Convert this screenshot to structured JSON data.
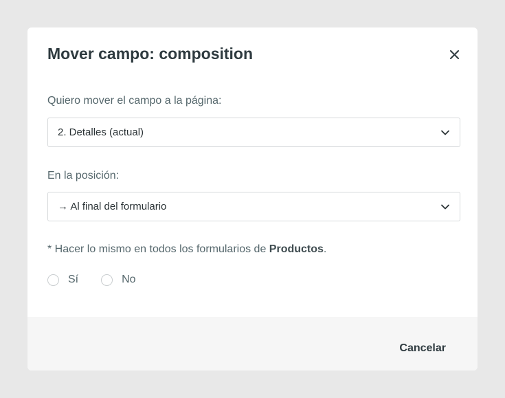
{
  "dialog": {
    "title": "Mover campo: composition",
    "close_icon": "close-icon"
  },
  "page_field": {
    "label": "Quiero mover el campo a la página:",
    "selected": "2. Detalles (actual)"
  },
  "position_field": {
    "label": "En la posición:",
    "selected": "→ Al final del formulario"
  },
  "apply_all": {
    "prefix": "* Hacer lo mismo en todos los formularios de ",
    "entity": "Productos",
    "suffix": ".",
    "options": [
      "Sí",
      "No"
    ],
    "selected": null
  },
  "footer": {
    "cancel_label": "Cancelar"
  }
}
